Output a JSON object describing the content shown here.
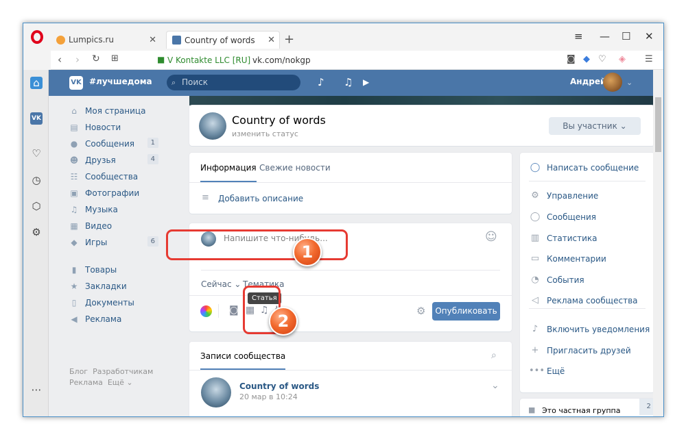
{
  "browser": {
    "tabs": [
      {
        "label": "Lumpics.ru",
        "fav_color": "#f4a13a"
      },
      {
        "label": "Country of words",
        "fav_color": "#4a76a8"
      }
    ],
    "security_label": "V Kontakte LLC [RU]",
    "url": "vk.com/nokgp"
  },
  "vk_header": {
    "logo": "VK",
    "hashtag": "#лучшедома",
    "search_placeholder": "Поиск",
    "user_name": "Андрей"
  },
  "left_menu": {
    "items": [
      {
        "label": "Моя страница",
        "icon": "home-icon",
        "glyph": "⌂",
        "count": ""
      },
      {
        "label": "Новости",
        "icon": "news-icon",
        "glyph": "▤",
        "count": ""
      },
      {
        "label": "Сообщения",
        "icon": "messages-icon",
        "glyph": "●",
        "count": "1"
      },
      {
        "label": "Друзья",
        "icon": "friends-icon",
        "glyph": "☻",
        "count": "4"
      },
      {
        "label": "Сообщества",
        "icon": "communities-icon",
        "glyph": "☷",
        "count": ""
      },
      {
        "label": "Фотографии",
        "icon": "photos-icon",
        "glyph": "▣",
        "count": ""
      },
      {
        "label": "Музыка",
        "icon": "music-icon",
        "glyph": "♫",
        "count": ""
      },
      {
        "label": "Видео",
        "icon": "video-icon",
        "glyph": "▦",
        "count": ""
      },
      {
        "label": "Игры",
        "icon": "games-icon",
        "glyph": "◆",
        "count": "6"
      }
    ],
    "items2": [
      {
        "label": "Товары",
        "icon": "goods-icon",
        "glyph": "▮"
      },
      {
        "label": "Закладки",
        "icon": "bookmarks-icon",
        "glyph": "★"
      },
      {
        "label": "Документы",
        "icon": "documents-icon",
        "glyph": "▯"
      },
      {
        "label": "Реклама",
        "icon": "ads-icon",
        "glyph": "◀"
      }
    ],
    "footer": {
      "blog": "Блог",
      "dev": "Разработчикам",
      "ads": "Реклама",
      "more": "Ещё ⌄"
    }
  },
  "group": {
    "name": "Country of words",
    "status": "изменить статус",
    "member_button": "Вы участник ⌄"
  },
  "info": {
    "tab_info": "Информация",
    "tab_news": "Свежие новости",
    "add_description": "Добавить описание"
  },
  "post_box": {
    "placeholder": "Напишите что-нибудь...",
    "now": "Сейчас ⌄",
    "topic": "Тематика",
    "tooltip": "Статья",
    "publish": "Опубликовать"
  },
  "posts": {
    "title": "Записи сообщества",
    "author": "Country of words",
    "date": "20 мар в 10:24"
  },
  "right_menu": {
    "write": "Написать сообщение",
    "items": [
      {
        "label": "Управление",
        "icon": "gear-icon",
        "glyph": "⚙"
      },
      {
        "label": "Сообщения",
        "icon": "message-bubble-icon",
        "glyph": "◯"
      },
      {
        "label": "Статистика",
        "icon": "stats-icon",
        "glyph": "▥"
      },
      {
        "label": "Комментарии",
        "icon": "comments-icon",
        "glyph": "▭"
      },
      {
        "label": "События",
        "icon": "events-icon",
        "glyph": "◔"
      },
      {
        "label": "Реклама сообщества",
        "icon": "megaphone-icon",
        "glyph": "◁"
      }
    ],
    "items2": [
      {
        "label": "Включить уведомления",
        "icon": "bell-icon",
        "glyph": "♪"
      },
      {
        "label": "Пригласить друзей",
        "icon": "invite-icon",
        "glyph": "+"
      },
      {
        "label": "Ещё",
        "icon": "more-icon",
        "glyph": "•••"
      }
    ],
    "private_group": "Это частная группа",
    "members_count": "2"
  },
  "annotations": {
    "step1": "1",
    "step2": "2"
  }
}
